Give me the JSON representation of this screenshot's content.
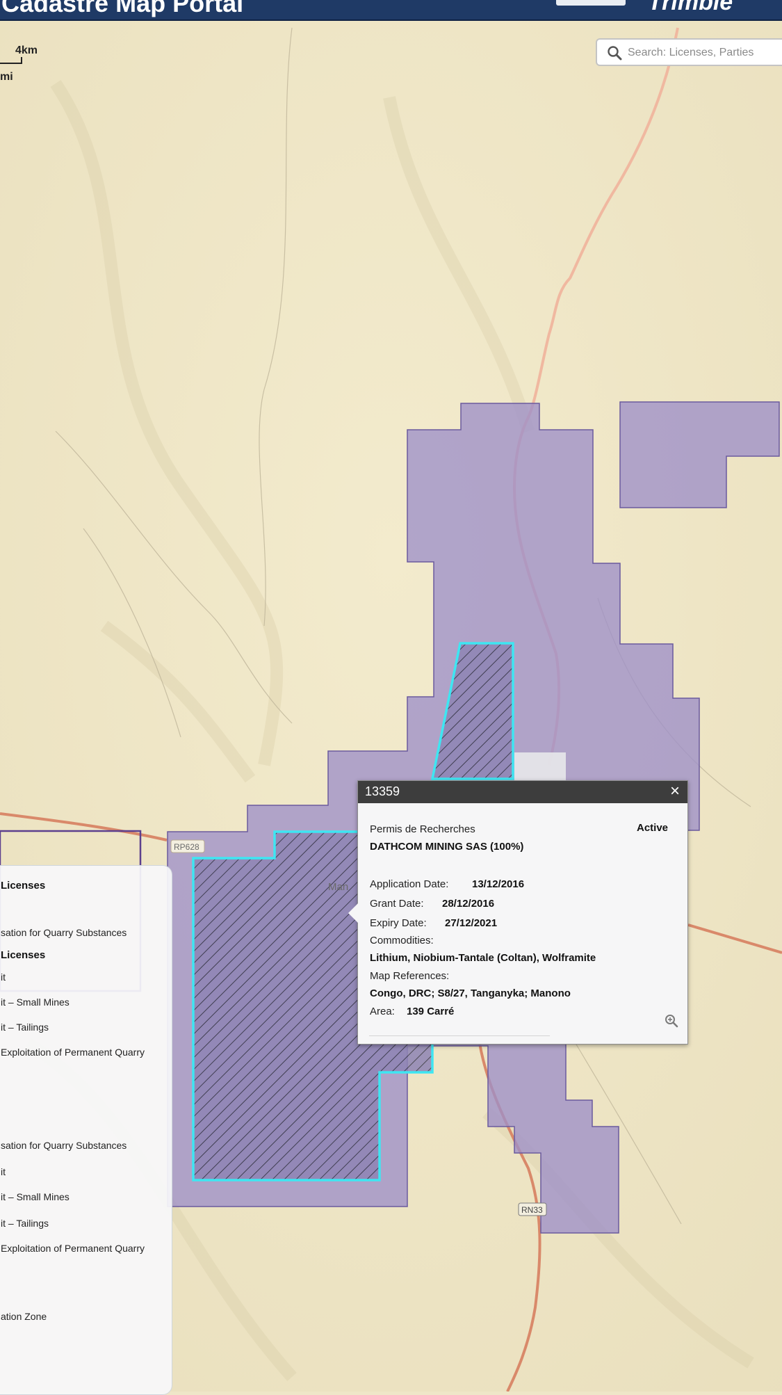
{
  "header": {
    "title": "Cadastre Map Portal",
    "logo": "Trimble"
  },
  "scale": {
    "km": "4km",
    "mi": "mi"
  },
  "search": {
    "placeholder": "Search: Licenses, Parties"
  },
  "map": {
    "road_labels": [
      "RP628",
      "RN33"
    ],
    "place_label": "Man"
  },
  "legend": {
    "section1_title": "Licenses",
    "section2_title": "Licenses",
    "items": [
      "sation for Quarry Substances",
      "it",
      "it – Small Mines",
      "it – Tailings",
      "Exploitation of Permanent Quarry",
      "sation for Quarry Substances",
      "it",
      "it – Small Mines",
      "it – Tailings",
      "Exploitation of Permanent Quarry",
      "ation Zone"
    ]
  },
  "popup": {
    "id": "13359",
    "close": "×",
    "type": "Permis de Recherches",
    "status": "Active",
    "holder": "DATHCOM MINING SAS (100%)",
    "application_label": "Application Date:",
    "application_date": "13/12/2016",
    "grant_label": "Grant Date:",
    "grant_date": "28/12/2016",
    "expiry_label": "Expiry Date:",
    "expiry_date": "27/12/2021",
    "commodities_label": "Commodities:",
    "commodities": "Lithium, Niobium-Tantale (Coltan), Wolframite",
    "map_refs_label": "Map References:",
    "map_refs": "Congo, DRC; S8/27, Tanganyka; Manono",
    "area_label": "Area:",
    "area": "139 Carré"
  },
  "colors": {
    "license_fill": "#9d90c8",
    "license_stroke": "#6a5a9e",
    "highlight_stroke": "#3ee6f2",
    "road": "#f0b8a0",
    "road_main": "#d9896a"
  }
}
